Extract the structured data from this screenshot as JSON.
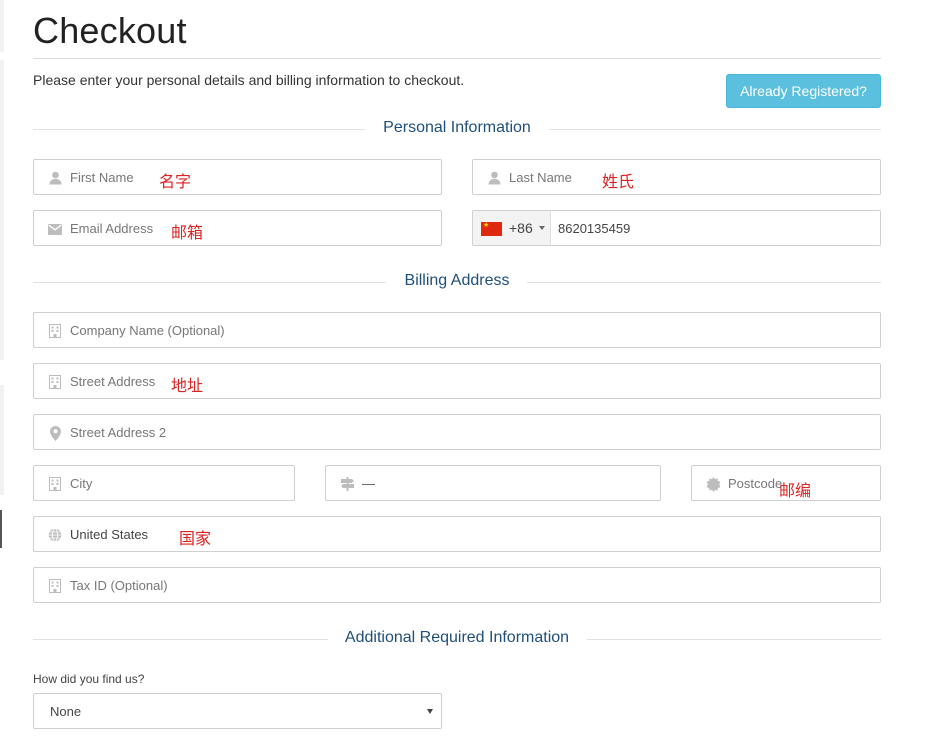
{
  "header": {
    "title": "Checkout",
    "intro": "Please enter your personal details and billing information to checkout.",
    "already_registered_label": "Already Registered?"
  },
  "sections": {
    "personal": "Personal Information",
    "billing": "Billing Address",
    "additional": "Additional Required Information"
  },
  "personal": {
    "first_name": {
      "placeholder": "First Name",
      "annotation": "名字",
      "icon": "user-icon"
    },
    "last_name": {
      "placeholder": "Last Name",
      "annotation": "姓氏",
      "icon": "user-icon"
    },
    "email": {
      "placeholder": "Email Address",
      "annotation": "邮箱",
      "icon": "envelope-icon"
    },
    "phone": {
      "country_flag": "china-flag-icon",
      "dial_code": "+86",
      "value": "8620135459"
    }
  },
  "billing": {
    "company": {
      "placeholder": "Company Name (Optional)",
      "icon": "building-icon"
    },
    "street": {
      "placeholder": "Street Address",
      "annotation": "地址",
      "icon": "building-icon"
    },
    "street2": {
      "placeholder": "Street Address 2",
      "icon": "map-marker-icon"
    },
    "city": {
      "placeholder": "City",
      "icon": "building-icon"
    },
    "state": {
      "value": "—",
      "icon": "signpost-icon"
    },
    "postcode": {
      "placeholder": "Postcode",
      "annotation": "邮编",
      "icon": "certificate-icon"
    },
    "country": {
      "value": "United States",
      "annotation": "国家",
      "icon": "globe-icon"
    },
    "tax_id": {
      "placeholder": "Tax ID (Optional)",
      "icon": "building-icon"
    }
  },
  "additional": {
    "question": "How did you find us?",
    "selected": "None"
  },
  "colors": {
    "accent_button": "#5bc0de",
    "section_heading": "#1f4f7a",
    "annotation": "#dd2222"
  }
}
